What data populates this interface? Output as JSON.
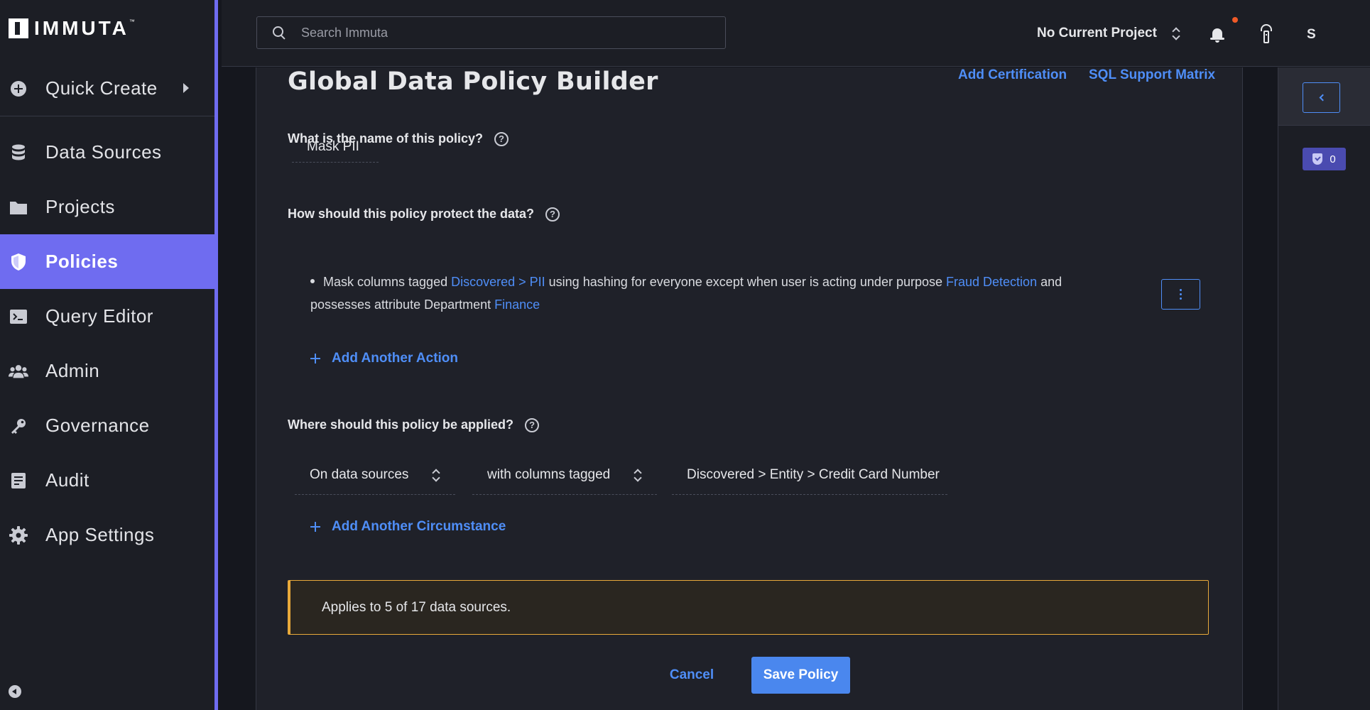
{
  "brand": {
    "name": "IMMUTA",
    "tm": "™"
  },
  "sidebar": {
    "quick_create": {
      "label": "Quick Create",
      "icon": "plus-circle-icon"
    },
    "items": [
      {
        "label": "Data Sources",
        "icon": "database-icon",
        "active": false
      },
      {
        "label": "Projects",
        "icon": "folder-icon",
        "active": false
      },
      {
        "label": "Policies",
        "icon": "shield-icon",
        "active": true
      },
      {
        "label": "Query Editor",
        "icon": "terminal-icon",
        "active": false
      },
      {
        "label": "Admin",
        "icon": "users-icon",
        "active": false
      },
      {
        "label": "Governance",
        "icon": "key-icon",
        "active": false
      },
      {
        "label": "Audit",
        "icon": "audit-icon",
        "active": false
      },
      {
        "label": "App Settings",
        "icon": "gear-icon",
        "active": false
      }
    ]
  },
  "topbar": {
    "search_placeholder": "Search Immuta",
    "project": "No Current Project",
    "user_initial": "S"
  },
  "main": {
    "title": "Global Data Policy Builder",
    "links": {
      "certification": "Add Certification",
      "sql_matrix": "SQL Support Matrix"
    },
    "q_name": "What is the name of this policy?",
    "policy_name": "Mask PII",
    "q_protect": "How should this policy protect the data?",
    "action": {
      "t1": "Mask columns tagged ",
      "tag": "Discovered > PII",
      "t2": " using hashing for everyone except when user is acting under purpose ",
      "purpose": "Fraud Detection",
      "t3": " and possesses attribute Department ",
      "attr": "Finance"
    },
    "add_action": "Add Another Action",
    "q_applied": "Where should this policy be applied?",
    "selects": {
      "scope": "On data sources",
      "condition": "with columns tagged",
      "tag": "Discovered > Entity > Credit Card Number"
    },
    "add_circumstance": "Add Another Circumstance",
    "applies": "Applies to 5 of 17 data sources.",
    "cancel": "Cancel",
    "save": "Save Policy"
  },
  "right_panel": {
    "badge_count": "0"
  },
  "colors": {
    "accent": "#6f6cf0",
    "link": "#4f8ef7",
    "warning": "#e8a93a",
    "notification": "#f05a28"
  }
}
